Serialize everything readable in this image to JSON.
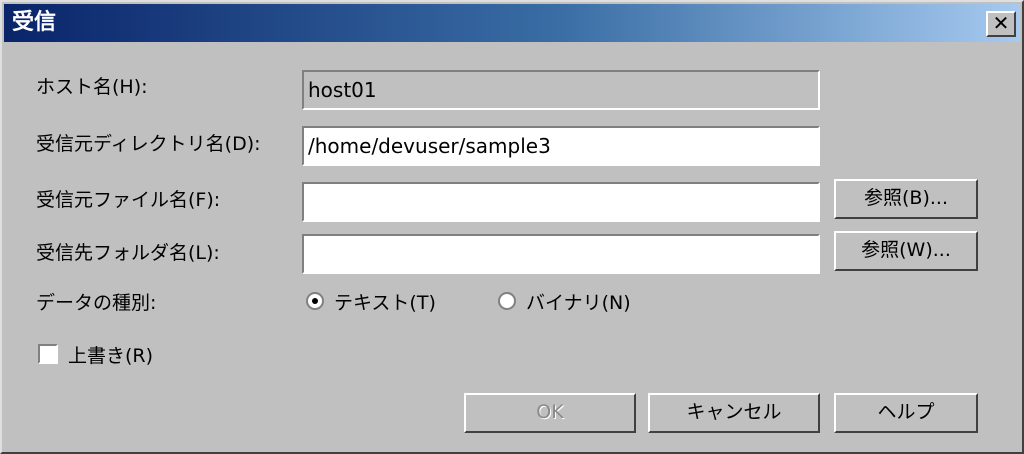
{
  "window": {
    "title": "受信",
    "close_glyph": "✕"
  },
  "fields": {
    "host": {
      "label": "ホスト名(H):",
      "value": "host01"
    },
    "source_dir": {
      "label": "受信元ディレクトリ名(D):",
      "value": "/home/devuser/sample3"
    },
    "source_file": {
      "label": "受信元ファイル名(F):",
      "value": ""
    },
    "dest_folder": {
      "label": "受信先フォルダ名(L):",
      "value": ""
    }
  },
  "browse_buttons": {
    "file": "参照(B)...",
    "folder": "参照(W)..."
  },
  "data_type": {
    "label": "データの種別:",
    "options": [
      {
        "label": "テキスト(T)",
        "selected": true
      },
      {
        "label": "バイナリ(N)",
        "selected": false
      }
    ]
  },
  "overwrite": {
    "label": "上書き(R)",
    "checked": false
  },
  "buttons": {
    "ok": "OK",
    "cancel": "キャンセル",
    "help": "ヘルプ"
  }
}
